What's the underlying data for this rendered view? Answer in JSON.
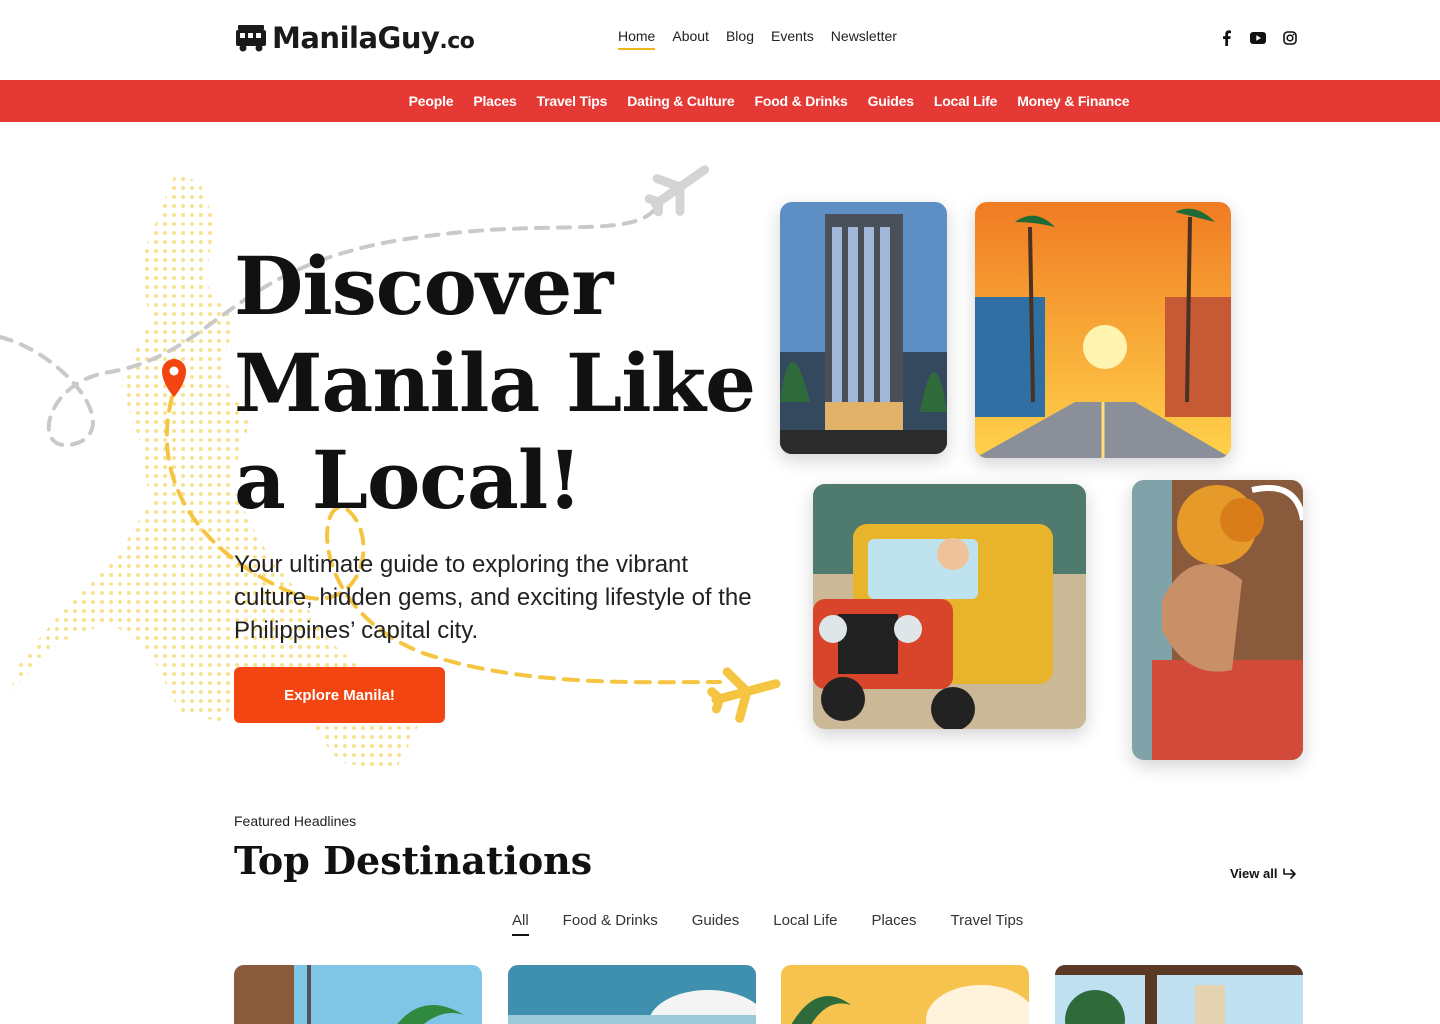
{
  "brand": {
    "name": "ManilaGuy",
    "tld": ".co"
  },
  "nav": {
    "items": [
      {
        "label": "Home",
        "active": true
      },
      {
        "label": "About"
      },
      {
        "label": "Blog"
      },
      {
        "label": "Events"
      },
      {
        "label": "Newsletter"
      }
    ]
  },
  "social": [
    "facebook-icon",
    "youtube-icon",
    "instagram-icon"
  ],
  "categories": [
    "People",
    "Places",
    "Travel Tips",
    "Dating & Culture",
    "Food & Drinks",
    "Guides",
    "Local Life",
    "Money & Finance"
  ],
  "hero": {
    "title": "Discover Manila Like a Local!",
    "subtitle": "Your ultimate guide to exploring the vibrant culture, hidden gems, and exciting lifestyle of the Philippines’ capital city.",
    "cta": "Explore Manila!"
  },
  "featured": {
    "eyebrow": "Featured Headlines",
    "title": "Top Destinations",
    "view_all": "View all",
    "filters": [
      {
        "label": "All",
        "active": true
      },
      {
        "label": "Food & Drinks"
      },
      {
        "label": "Guides"
      },
      {
        "label": "Local Life"
      },
      {
        "label": "Places"
      },
      {
        "label": "Travel Tips"
      }
    ]
  },
  "colors": {
    "accent_red": "#e53935",
    "cta_orange": "#f24511",
    "nav_underline": "#f1b420",
    "route_yellow": "#f5c542"
  }
}
